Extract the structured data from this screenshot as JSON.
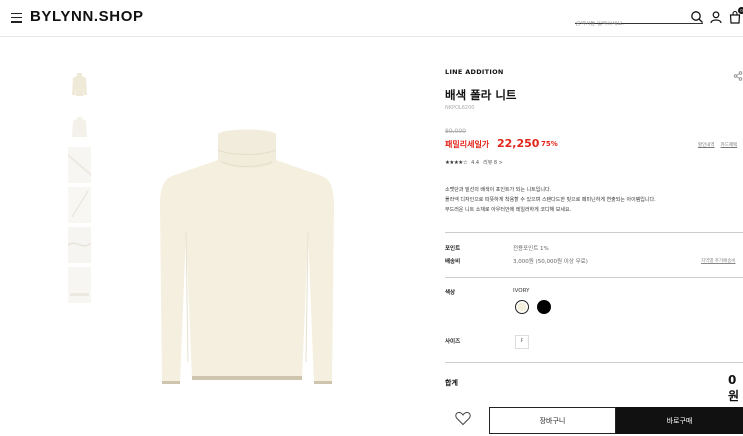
{
  "header": {
    "logo": "BYLYNN.SHOP",
    "search_placeholder": "검색어를 입력하세요.",
    "cart_count": "0"
  },
  "icons": [
    "menu-icon",
    "search-icon",
    "user-icon",
    "cart-icon",
    "share-icon",
    "heart-icon"
  ],
  "product": {
    "brand": "LINE ADDITION",
    "title": "배색 폴라 니트",
    "code": "NKPOL6200",
    "original_price": "89,000",
    "sale_label": "패밀리세일가",
    "sale_price": "22,250",
    "discount": "75%",
    "price_links": [
      "할인내역",
      "카드혜택"
    ],
    "rating_stars": "★★★★☆",
    "rating_value": "4.4",
    "reviews": "리뷰 8 >",
    "description": [
      "소맷단과 밑선의 배색이 포인트가 되는 니트입니다.",
      "폴라넥 디자인으로 따뜻하게 착용할 수 있으며 스탠다드한 핏으로 페미닌하게 연출되는 아이템입니다.",
      "부드러운 니트 소재로 아우터안에 레일러하게 코디해 보세요."
    ]
  },
  "details": {
    "point_label": "포인트",
    "point_value": "전용포인트 1%",
    "shipping_label": "배송비",
    "shipping_value": "3,000원 (50,000원 이상 무료)",
    "shipping_link": "지역별 추가배송비",
    "color_label": "색상",
    "color_value": "IVORY",
    "size_label": "사이즈",
    "size_value": "F",
    "total_label": "합계",
    "total_value": "0원"
  },
  "swatches": [
    {
      "name": "ivory",
      "color": "#f4efdc"
    },
    {
      "name": "black",
      "color": "#000000"
    }
  ],
  "actions": {
    "cart_button": "장바구니",
    "buy_button": "바로구매"
  },
  "colors": {
    "accent": "#e2261c",
    "dark": "#111111",
    "sweater": "#f4efdf"
  }
}
